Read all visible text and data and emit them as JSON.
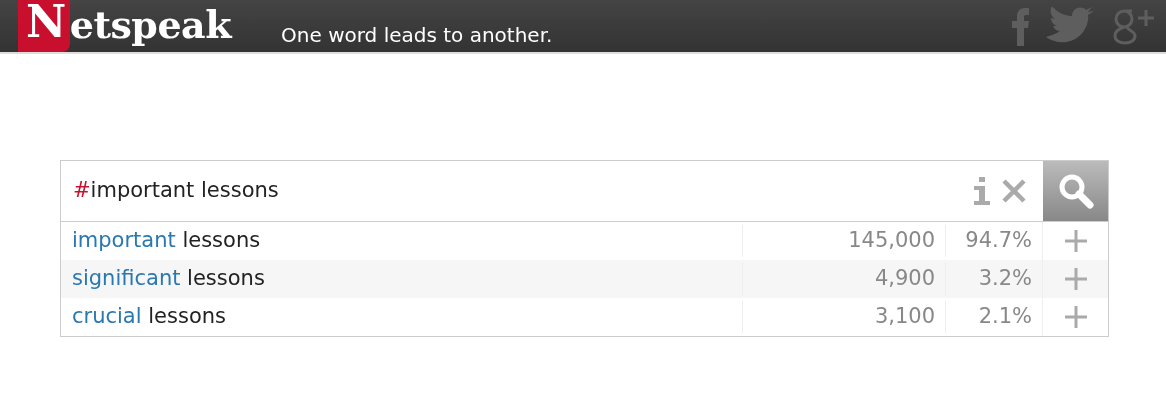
{
  "header": {
    "logo": {
      "initial": "N",
      "rest": "etspeak"
    },
    "tagline": "One word leads to another."
  },
  "search": {
    "prefix": "#",
    "query": "important lessons"
  },
  "results": [
    {
      "word": "important",
      "rest": " lessons",
      "count": "145,000",
      "percent": "94.7%"
    },
    {
      "word": "significant",
      "rest": " lessons",
      "count": "4,900",
      "percent": "3.2%"
    },
    {
      "word": "crucial",
      "rest": " lessons",
      "count": "3,100",
      "percent": "2.1%"
    }
  ]
}
